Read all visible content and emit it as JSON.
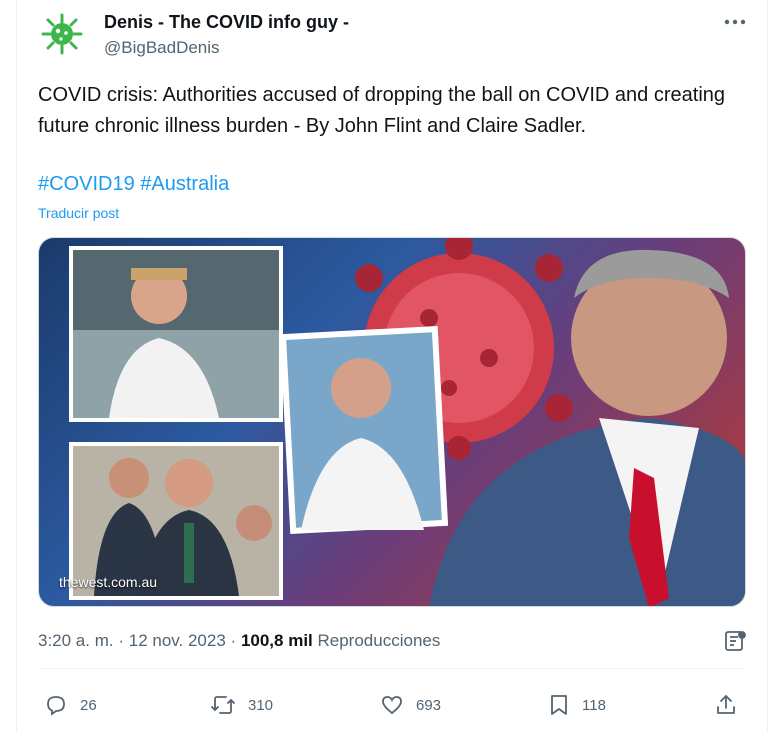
{
  "author": {
    "display_name": "Denis - The COVID info guy -",
    "handle": "@BigBadDenis",
    "avatar_icon": "virus-icon",
    "avatar_color": "#3fb64a"
  },
  "tweet": {
    "text": "COVID crisis: Authorities accused of dropping the ball on COVID and creating future chronic illness burden - By John Flint and Claire Sadler.",
    "hashtags": [
      "#COVID19",
      "#Australia"
    ],
    "translate_label": "Traducir post"
  },
  "media": {
    "watermark": "thewest.com.au"
  },
  "meta": {
    "time": "3:20 a. m.",
    "separator": "·",
    "date": "12 nov. 2023",
    "views_count": "100,8 mil",
    "views_label": "Reproducciones"
  },
  "actions": {
    "replies": "26",
    "reposts": "310",
    "likes": "693",
    "bookmarks": "118"
  },
  "colors": {
    "link": "#1d9bf0",
    "muted": "#536471",
    "text": "#0f1419",
    "tie_red": "#c8102e"
  }
}
